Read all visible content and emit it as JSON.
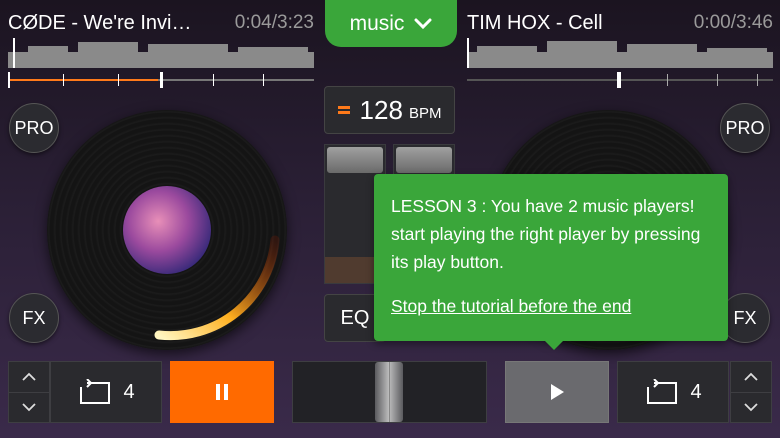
{
  "deck_left": {
    "track_title": "CØDE - We're Invi…",
    "time_elapsed": "0:04",
    "time_total": "3:23",
    "time_sep": "/",
    "loop_count": "4",
    "pro_label": "PRO",
    "fx_label": "FX"
  },
  "deck_right": {
    "track_title": "TIM HOX - Cell",
    "time_elapsed": "0:00",
    "time_total": "3:46",
    "time_sep": "/",
    "loop_count": "4",
    "pro_label": "PRO",
    "fx_label": "FX"
  },
  "music_tab": {
    "label": "music"
  },
  "bpm": {
    "value": "128",
    "unit": "BPM"
  },
  "eq": {
    "label": "EQ"
  },
  "tutorial": {
    "text": "LESSON 3 : You have 2 music players! start playing the right player by pressing its play button.",
    "stop_link": "Stop the tutorial before the end"
  },
  "colors": {
    "accent_green": "#3aa63a",
    "accent_orange": "#ff6a00"
  }
}
